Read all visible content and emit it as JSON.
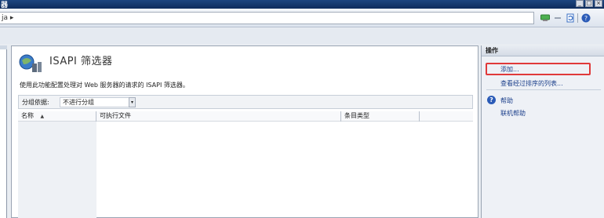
{
  "window": {
    "title": "器",
    "controls": [
      "_",
      "□",
      "×"
    ]
  },
  "address": {
    "text": "ja ▸"
  },
  "toolbar": {
    "icons": [
      "network-icon",
      "stop-icon",
      "refresh-icon",
      "help-icon"
    ]
  },
  "feature": {
    "title": "ISAPI  筛选器",
    "description": "使用此功能配置处理对 Web 服务器的请求的 ISAPI 筛选器。"
  },
  "filter": {
    "group_label": "分组依据:",
    "group_value": "不进行分组",
    "arrow": "▾"
  },
  "list": {
    "columns": [
      "名称",
      "可执行文件",
      "条目类型",
      ""
    ],
    "sort_indicator": "▲",
    "rows": []
  },
  "actions": {
    "header": "操作",
    "add": "添加...",
    "view_sorted": "查看经过排序的列表...",
    "help": "帮助",
    "online_help": "联机帮助"
  },
  "colors": {
    "highlight": "#e0393a",
    "link": "#1b3f8b",
    "titlebar": "#163a70"
  }
}
